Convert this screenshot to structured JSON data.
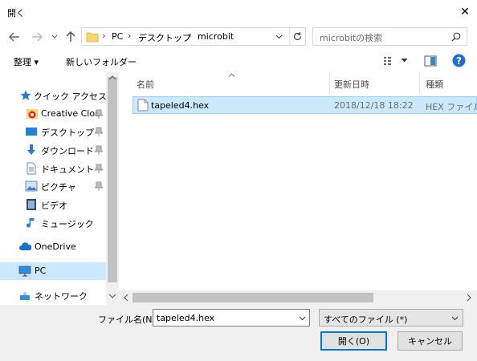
{
  "window": {
    "title": "開く",
    "close_symbol": "✕"
  },
  "address": {
    "crumbs": [
      "PC",
      "デスクトップ",
      "microbit"
    ]
  },
  "search": {
    "placeholder": "microbitの検索"
  },
  "toolbar": {
    "organize_label": "整理 ▾",
    "new_folder_label": "新しいフォルダー"
  },
  "navpane": {
    "items": [
      {
        "label": "クイック アクセス",
        "icon": "star-icon"
      },
      {
        "label": "Creative Clou",
        "icon": "creative-cloud-icon"
      },
      {
        "label": "デスクトップ",
        "icon": "desktop-icon"
      },
      {
        "label": "ダウンロード",
        "icon": "download-icon"
      },
      {
        "label": "ドキュメント",
        "icon": "document-icon"
      },
      {
        "label": "ピクチャ",
        "icon": "picture-icon"
      },
      {
        "label": "ビデオ",
        "icon": "video-icon"
      },
      {
        "label": "ミュージック",
        "icon": "music-icon"
      },
      {
        "label": "OneDrive",
        "icon": "onedrive-icon"
      },
      {
        "label": "PC",
        "icon": "pc-icon"
      },
      {
        "label": "ネットワーク",
        "icon": "network-icon"
      }
    ]
  },
  "filelist": {
    "columns": {
      "name": "名前",
      "date": "更新日時",
      "type": "種類"
    },
    "rows": [
      {
        "name": "tapeled4.hex",
        "date": "2018/12/18 18:22",
        "type": "HEX ファイル"
      }
    ]
  },
  "footer": {
    "filename_label": "ファイル名(N):",
    "filename_value": "tapeled4.hex",
    "filetype_value": "すべてのファイル (*)",
    "open_label": "開く(O)",
    "cancel_label": "キャンセル"
  },
  "colors": {
    "selection": "#cce8ff",
    "accent": "#0078d7",
    "help": "#1e6fc9"
  }
}
